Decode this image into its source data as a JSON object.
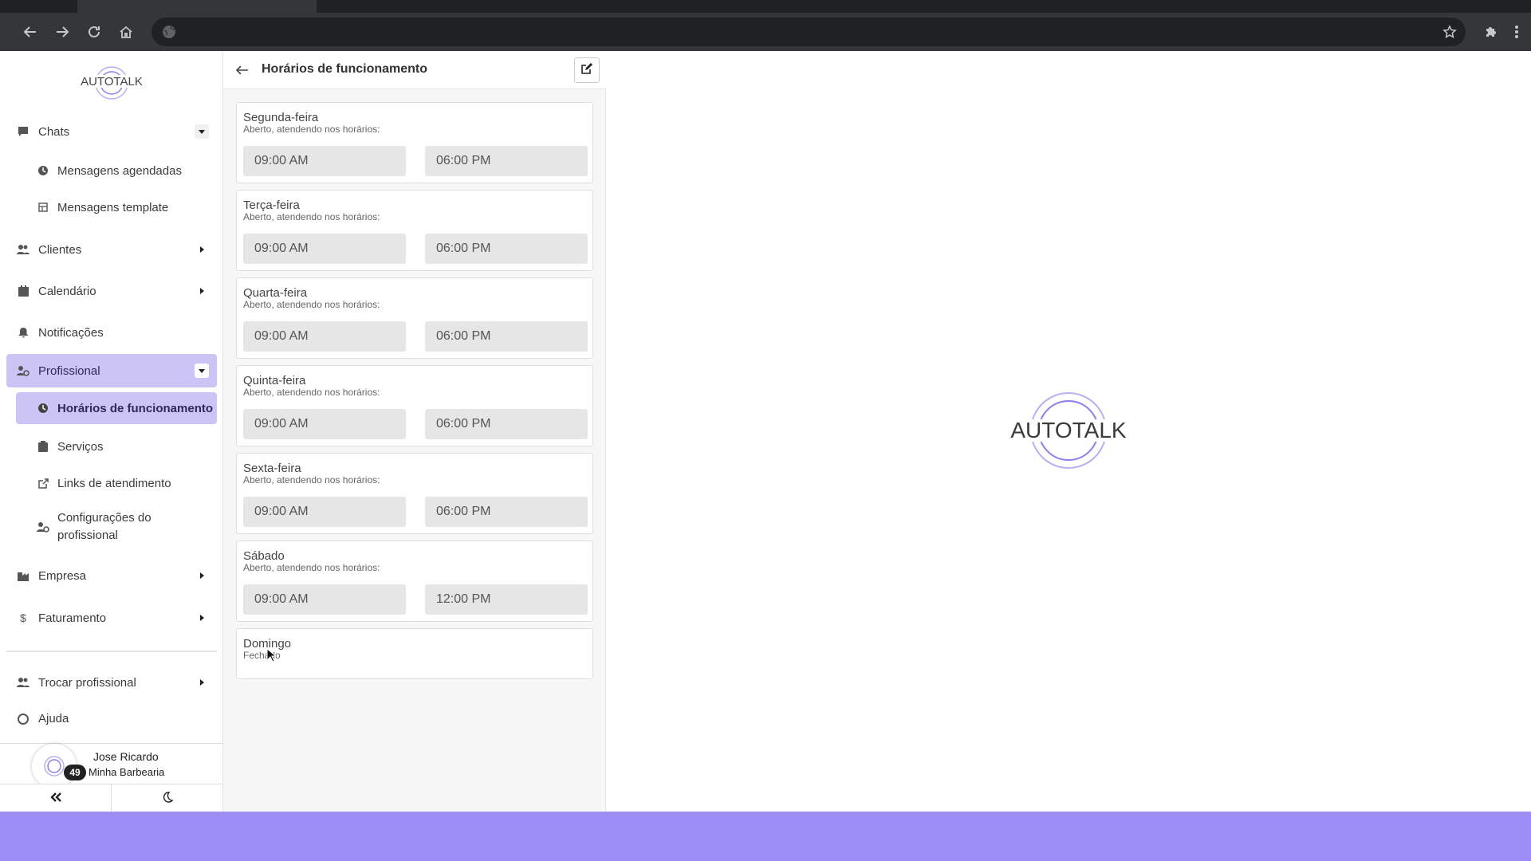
{
  "colors": {
    "accent_active": "#cbc4f5",
    "bottom_bar": "#9c8ef5",
    "logo_ring": "#8b7ff0"
  },
  "browser": {
    "icons": [
      "back-arrow-icon",
      "forward-arrow-icon",
      "reload-icon",
      "home-icon",
      "globe-icon",
      "star-icon",
      "puzzle-icon",
      "kebab-menu-icon"
    ]
  },
  "brand": {
    "logo_text": "AUTOTALK"
  },
  "sidebar": {
    "items": [
      {
        "label": "Chats",
        "icon": "chat-icon",
        "caret": "down"
      },
      {
        "label": "Mensagens agendadas",
        "icon": "clock-icon"
      },
      {
        "label": "Mensagens template",
        "icon": "template-icon"
      },
      {
        "label": "Clientes",
        "icon": "users-icon",
        "caret": "right"
      },
      {
        "label": "Calendário",
        "icon": "calendar-icon",
        "caret": "right"
      },
      {
        "label": "Notificações",
        "icon": "bell-icon"
      },
      {
        "label": "Profissional",
        "icon": "user-gear-icon",
        "caret": "down",
        "active": true
      },
      {
        "label": "Horários de funcionamento",
        "icon": "clock-icon",
        "active": true
      },
      {
        "label": "Serviços",
        "icon": "clipboard-icon"
      },
      {
        "label": "Links de atendimento",
        "icon": "external-link-icon"
      },
      {
        "label": "Configurações do profissional",
        "icon": "user-gear-icon"
      },
      {
        "label": "Empresa",
        "icon": "building-icon",
        "caret": "right"
      },
      {
        "label": "Faturamento",
        "icon": "dollar-icon",
        "caret": "right"
      },
      {
        "label": "Trocar profissional",
        "icon": "users-swap-icon",
        "caret": "right"
      },
      {
        "label": "Ajuda",
        "icon": "help-icon",
        "caret": "right"
      }
    ],
    "profile": {
      "name": "Jose Ricardo",
      "company": "Minha Barbearia",
      "badge": "49",
      "collapse_icon": "double-chevron-left-icon",
      "theme_icon": "moon-icon"
    }
  },
  "panel": {
    "title": "Horários de funcionamento",
    "edit_icon": "edit-icon",
    "days": [
      {
        "name": "Segunda-feira",
        "status": "Aberto, atendendo nos horários:",
        "open": "09:00 AM",
        "close": "06:00 PM"
      },
      {
        "name": "Terça-feira",
        "status": "Aberto, atendendo nos horários:",
        "open": "09:00 AM",
        "close": "06:00 PM"
      },
      {
        "name": "Quarta-feira",
        "status": "Aberto, atendendo nos horários:",
        "open": "09:00 AM",
        "close": "06:00 PM"
      },
      {
        "name": "Quinta-feira",
        "status": "Aberto, atendendo nos horários:",
        "open": "09:00 AM",
        "close": "06:00 PM"
      },
      {
        "name": "Sexta-feira",
        "status": "Aberto, atendendo nos horários:",
        "open": "09:00 AM",
        "close": "06:00 PM"
      },
      {
        "name": "Sábado",
        "status": "Aberto, atendendo nos horários:",
        "open": "09:00 AM",
        "close": "12:00 PM"
      },
      {
        "name": "Domingo",
        "status": "Fechado"
      }
    ]
  }
}
